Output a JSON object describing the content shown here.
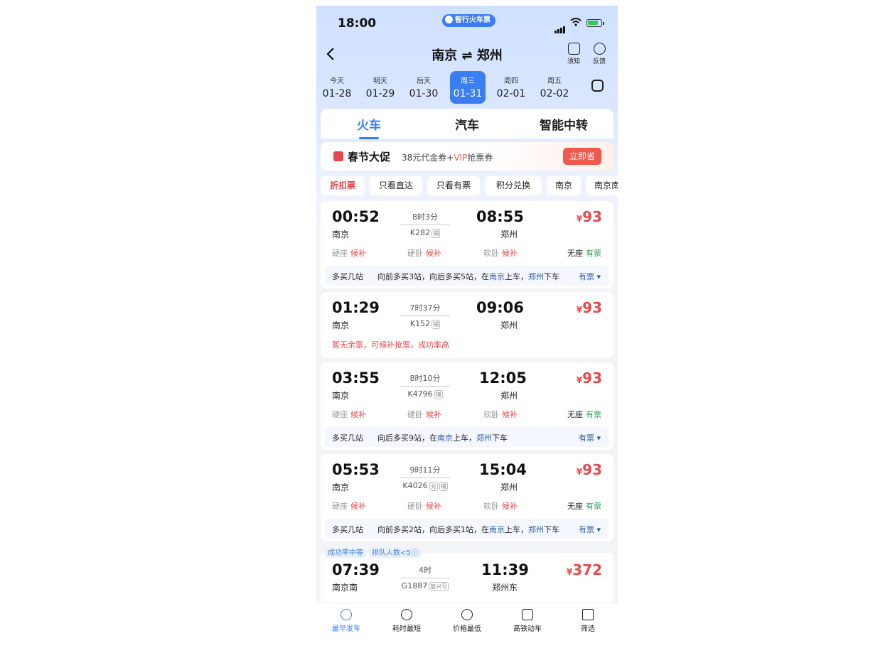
{
  "status": {
    "time": "18:00",
    "app_badge": "智行火车票"
  },
  "nav": {
    "route": "南京 ⇌ 郑州",
    "notice_label": "须知",
    "feedback_label": "反馈"
  },
  "dates": [
    {
      "week": "今天",
      "date": "01-28",
      "selected": false
    },
    {
      "week": "明天",
      "date": "01-29",
      "selected": false
    },
    {
      "week": "后天",
      "date": "01-30",
      "selected": false
    },
    {
      "week": "周三",
      "date": "01-31",
      "selected": true
    },
    {
      "week": "周四",
      "date": "02-01",
      "selected": false
    },
    {
      "week": "周五",
      "date": "02-02",
      "selected": false
    }
  ],
  "tabs": [
    {
      "label": "火车",
      "active": true
    },
    {
      "label": "汽车",
      "active": false
    },
    {
      "label": "智能中转",
      "active": false
    }
  ],
  "promo": {
    "title": "春节大促",
    "desc": "38元代金券+",
    "vip": "VIP",
    "desc2": "抢票券",
    "button": "立即省"
  },
  "filters": [
    "折扣票",
    "只看直达",
    "只看有票",
    "积分兑换",
    "南京",
    "南京南"
  ],
  "trains": [
    {
      "dep_time": "00:52",
      "dep_station": "南京",
      "duration": "8时3分",
      "train_no": "K282",
      "tags": [
        "铺"
      ],
      "arr_time": "08:55",
      "arr_station": "郑州",
      "price_sym": "¥",
      "price": "93",
      "seats": [
        {
          "name": "硬座",
          "status": "候补"
        },
        {
          "name": "硬卧",
          "status": "候补"
        },
        {
          "name": "软卧",
          "status": "候补"
        },
        {
          "name": "无座",
          "status": "有票"
        }
      ],
      "extra": {
        "label": "多买几站",
        "p1": "向前多买3站，向后多买5站，在",
        "from": "南京",
        "p2": "上车，",
        "to": "郑州",
        "p3": "下车",
        "status": "有票 ▾"
      }
    },
    {
      "dep_time": "01:29",
      "dep_station": "南京",
      "duration": "7时37分",
      "train_no": "K152",
      "tags": [
        "铺"
      ],
      "arr_time": "09:06",
      "arr_station": "郑州",
      "price_sym": "¥",
      "price": "93",
      "warn": "暂无余票，可候补抢票，成功率高"
    },
    {
      "dep_time": "03:55",
      "dep_station": "南京",
      "duration": "8时10分",
      "train_no": "K4796",
      "tags": [
        "铺"
      ],
      "arr_time": "12:05",
      "arr_station": "郑州",
      "price_sym": "¥",
      "price": "93",
      "seats": [
        {
          "name": "硬座",
          "status": "候补"
        },
        {
          "name": "硬卧",
          "status": "候补"
        },
        {
          "name": "软卧",
          "status": "候补"
        },
        {
          "name": "无座",
          "status": "有票"
        }
      ],
      "extra": {
        "label": "多买几站",
        "p1": "向后多买9站，在",
        "from": "南京",
        "p2": "上车，",
        "to": "郑州",
        "p3": "下车",
        "status": "有票 ▾"
      }
    },
    {
      "dep_time": "05:53",
      "dep_station": "南京",
      "duration": "9时11分",
      "train_no": "K4026",
      "tags": [
        "兑",
        "铺"
      ],
      "arr_time": "15:04",
      "arr_station": "郑州",
      "price_sym": "¥",
      "price": "93",
      "seats": [
        {
          "name": "硬座",
          "status": "候补"
        },
        {
          "name": "硬卧",
          "status": "候补"
        },
        {
          "name": "软卧",
          "status": "候补"
        },
        {
          "name": "无座",
          "status": "有票"
        }
      ],
      "extra": {
        "label": "多买几站",
        "p1": "向前多买2站，向后多买1站，在",
        "from": "南京",
        "p2": "上车，",
        "to": "郑州",
        "p3": "下车",
        "status": "有票 ▾"
      }
    },
    {
      "badges": [
        "成功率中等",
        "排队人数<5ⓘ"
      ],
      "dep_time": "07:39",
      "dep_station": "南京南",
      "duration": "4时",
      "train_no": "G1887",
      "tags": [
        "复兴号"
      ],
      "arr_time": "11:39",
      "arr_station": "郑州东",
      "price_sym": "¥",
      "price": "372"
    }
  ],
  "bottom": [
    {
      "label": "最早发车",
      "icon": "clock-icon",
      "active": true
    },
    {
      "label": "耗时最短",
      "icon": "hourglass-icon",
      "active": false
    },
    {
      "label": "价格最低",
      "icon": "yuan-icon",
      "active": false
    },
    {
      "label": "高铁动车",
      "icon": "train-icon",
      "active": false
    },
    {
      "label": "筛选",
      "icon": "filter-icon",
      "active": false
    }
  ],
  "colors": {
    "accent": "#3a7ef2",
    "price": "#e8484d",
    "available": "#2e9d55",
    "link": "#2d5dab"
  }
}
